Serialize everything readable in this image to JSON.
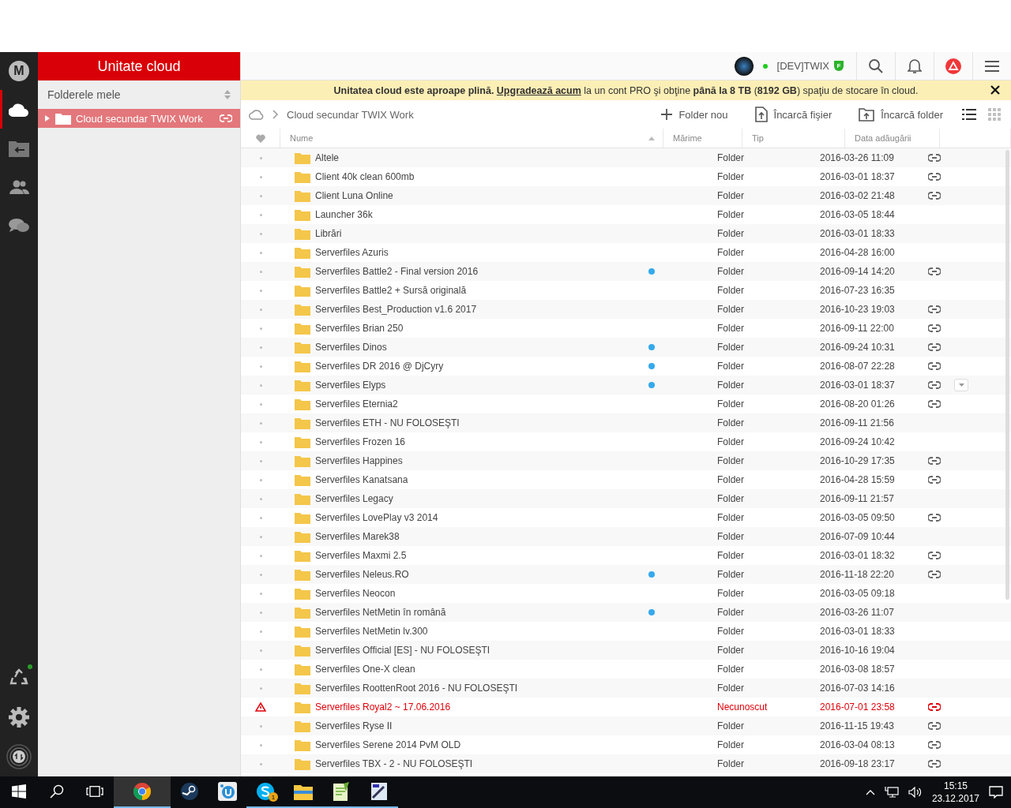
{
  "rail": {
    "logo": "M",
    "items": [
      {
        "kind": "cloud",
        "selected": true
      },
      {
        "kind": "inbox",
        "selected": false
      },
      {
        "kind": "contacts",
        "selected": false
      },
      {
        "kind": "chat",
        "selected": false
      }
    ],
    "bottom": [
      {
        "kind": "rubbish",
        "notify": true
      },
      {
        "kind": "settings"
      },
      {
        "kind": "transfers"
      }
    ]
  },
  "sidebar": {
    "title": "Unitate cloud",
    "section": "Folderele mele",
    "tree": [
      {
        "label": "Cloud secundar TWIX Work",
        "selected": true,
        "expanded": false,
        "linked": true
      }
    ]
  },
  "topbar": {
    "user": "[DEV]TWIX",
    "online": true,
    "badge": "F",
    "warning": true
  },
  "banner": {
    "before": "**Unitatea cloud este aproape plină.** ",
    "link": "Upgradează acum",
    "after": " la un cont PRO şi obţine **până la 8 TB** (**8192 GB**) spaţiu de stocare în cloud."
  },
  "toolbar": {
    "breadcrumb": "Cloud secundar TWIX Work",
    "actions": [
      {
        "kind": "new-folder",
        "label": "Folder nou"
      },
      {
        "kind": "upload-file",
        "label": "Încarcă fişier"
      },
      {
        "kind": "upload-folder",
        "label": "Încarcă folder"
      }
    ],
    "views": [
      {
        "kind": "list",
        "selected": true
      },
      {
        "kind": "grid",
        "selected": false
      }
    ]
  },
  "table": {
    "columns": [
      "Nume",
      "Mărime",
      "Tip",
      "Data adăugării"
    ],
    "rows": [
      {
        "name": "Altele",
        "type": "Folder",
        "date": "2016-03-26 11:09",
        "shared": false,
        "linked": true,
        "error": false,
        "menu": false
      },
      {
        "name": "Client 40k clean 600mb",
        "type": "Folder",
        "date": "2016-03-01 18:37",
        "shared": false,
        "linked": true,
        "error": false,
        "menu": false
      },
      {
        "name": "Client Luna Online",
        "type": "Folder",
        "date": "2016-03-02 21:48",
        "shared": false,
        "linked": true,
        "error": false,
        "menu": false
      },
      {
        "name": "Launcher 36k",
        "type": "Folder",
        "date": "2016-03-05 18:44",
        "shared": false,
        "linked": false,
        "error": false,
        "menu": false
      },
      {
        "name": "Librări",
        "type": "Folder",
        "date": "2016-03-01 18:33",
        "shared": false,
        "linked": false,
        "error": false,
        "menu": false
      },
      {
        "name": "Serverfiles Azuris",
        "type": "Folder",
        "date": "2016-04-28 16:00",
        "shared": false,
        "linked": false,
        "error": false,
        "menu": false
      },
      {
        "name": "Serverfiles Battle2 - Final version 2016",
        "type": "Folder",
        "date": "2016-09-14 14:20",
        "shared": true,
        "linked": true,
        "error": false,
        "menu": false
      },
      {
        "name": "Serverfiles Battle2 + Sursă originală",
        "type": "Folder",
        "date": "2016-07-23 16:35",
        "shared": false,
        "linked": false,
        "error": false,
        "menu": false
      },
      {
        "name": "Serverfiles Best_Production v1.6 2017",
        "type": "Folder",
        "date": "2016-10-23 19:03",
        "shared": false,
        "linked": true,
        "error": false,
        "menu": false
      },
      {
        "name": "Serverfiles Brian 250",
        "type": "Folder",
        "date": "2016-09-11 22:00",
        "shared": false,
        "linked": true,
        "error": false,
        "menu": false
      },
      {
        "name": "Serverfiles Dinos",
        "type": "Folder",
        "date": "2016-09-24 10:31",
        "shared": true,
        "linked": true,
        "error": false,
        "menu": false
      },
      {
        "name": "Serverfiles DR 2016 @ DjCyry",
        "type": "Folder",
        "date": "2016-08-07 22:28",
        "shared": true,
        "linked": true,
        "error": false,
        "menu": false
      },
      {
        "name": "Serverfiles Elyps",
        "type": "Folder",
        "date": "2016-03-01 18:37",
        "shared": true,
        "linked": true,
        "error": false,
        "menu": true
      },
      {
        "name": "Serverfiles Eternia2",
        "type": "Folder",
        "date": "2016-08-20 01:26",
        "shared": false,
        "linked": true,
        "error": false,
        "menu": false
      },
      {
        "name": "Serverfiles ETH - NU FOLOSEŞTI",
        "type": "Folder",
        "date": "2016-09-11 21:56",
        "shared": false,
        "linked": false,
        "error": false,
        "menu": false
      },
      {
        "name": "Serverfiles Frozen 16",
        "type": "Folder",
        "date": "2016-09-24 10:42",
        "shared": false,
        "linked": false,
        "error": false,
        "menu": false
      },
      {
        "name": "Serverfiles Happines",
        "type": "Folder",
        "date": "2016-10-29 17:35",
        "shared": false,
        "linked": true,
        "error": false,
        "menu": false
      },
      {
        "name": "Serverfiles Kanatsana",
        "type": "Folder",
        "date": "2016-04-28 15:59",
        "shared": false,
        "linked": true,
        "error": false,
        "menu": false
      },
      {
        "name": "Serverfiles Legacy",
        "type": "Folder",
        "date": "2016-09-11 21:57",
        "shared": false,
        "linked": false,
        "error": false,
        "menu": false
      },
      {
        "name": "Serverfiles LovePlay v3 2014",
        "type": "Folder",
        "date": "2016-03-05 09:50",
        "shared": false,
        "linked": true,
        "error": false,
        "menu": false
      },
      {
        "name": "Serverfiles Marek38",
        "type": "Folder",
        "date": "2016-07-09 10:44",
        "shared": false,
        "linked": false,
        "error": false,
        "menu": false
      },
      {
        "name": "Serverfiles Maxmi 2.5",
        "type": "Folder",
        "date": "2016-03-01 18:32",
        "shared": false,
        "linked": true,
        "error": false,
        "menu": false
      },
      {
        "name": "Serverfiles Neleus.RO",
        "type": "Folder",
        "date": "2016-11-18 22:20",
        "shared": true,
        "linked": true,
        "error": false,
        "menu": false
      },
      {
        "name": "Serverfiles Neocon",
        "type": "Folder",
        "date": "2016-03-05 09:18",
        "shared": false,
        "linked": false,
        "error": false,
        "menu": false
      },
      {
        "name": "Serverfiles NetMetin în română",
        "type": "Folder",
        "date": "2016-03-26 11:07",
        "shared": true,
        "linked": false,
        "error": false,
        "menu": false
      },
      {
        "name": "Serverfiles NetMetin lv.300",
        "type": "Folder",
        "date": "2016-03-01 18:33",
        "shared": false,
        "linked": false,
        "error": false,
        "menu": false
      },
      {
        "name": "Serverfiles Official [ES] - NU FOLOSEŞTI",
        "type": "Folder",
        "date": "2016-10-16 19:04",
        "shared": false,
        "linked": false,
        "error": false,
        "menu": false
      },
      {
        "name": "Serverfiles One-X clean",
        "type": "Folder",
        "date": "2016-03-08 18:57",
        "shared": false,
        "linked": false,
        "error": false,
        "menu": false
      },
      {
        "name": "Serverfiles RoottenRoot 2016 - NU FOLOSEŞTI",
        "type": "Folder",
        "date": "2016-07-03 14:16",
        "shared": false,
        "linked": false,
        "error": false,
        "menu": false
      },
      {
        "name": "Serverfiles Royal2 ~ 17.06.2016",
        "type": "Necunoscut",
        "date": "2016-07-01 23:58",
        "shared": false,
        "linked": true,
        "error": true,
        "menu": false
      },
      {
        "name": "Serverfiles Ryse II",
        "type": "Folder",
        "date": "2016-11-15 19:43",
        "shared": false,
        "linked": true,
        "error": false,
        "menu": false
      },
      {
        "name": "Serverfiles Serene 2014 PvM OLD",
        "type": "Folder",
        "date": "2016-03-04 08:13",
        "shared": false,
        "linked": true,
        "error": false,
        "menu": false
      },
      {
        "name": "Serverfiles TBX - 2 - NU FOLOSEŞTI",
        "type": "Folder",
        "date": "2016-09-18 23:17",
        "shared": false,
        "linked": true,
        "error": false,
        "menu": false
      }
    ]
  },
  "taskbar": {
    "apps": [
      {
        "kind": "chrome",
        "running": true,
        "active": true
      },
      {
        "kind": "steam",
        "running": false,
        "active": false
      },
      {
        "kind": "uplay",
        "running": false,
        "active": false
      },
      {
        "kind": "skype",
        "running": true,
        "active": false,
        "badge": "1"
      },
      {
        "kind": "explorer",
        "running": true,
        "active": false
      },
      {
        "kind": "notepad",
        "running": true,
        "active": false
      },
      {
        "kind": "editor",
        "running": true,
        "active": false
      }
    ],
    "time": "15:15",
    "date": "23.12.2017"
  }
}
